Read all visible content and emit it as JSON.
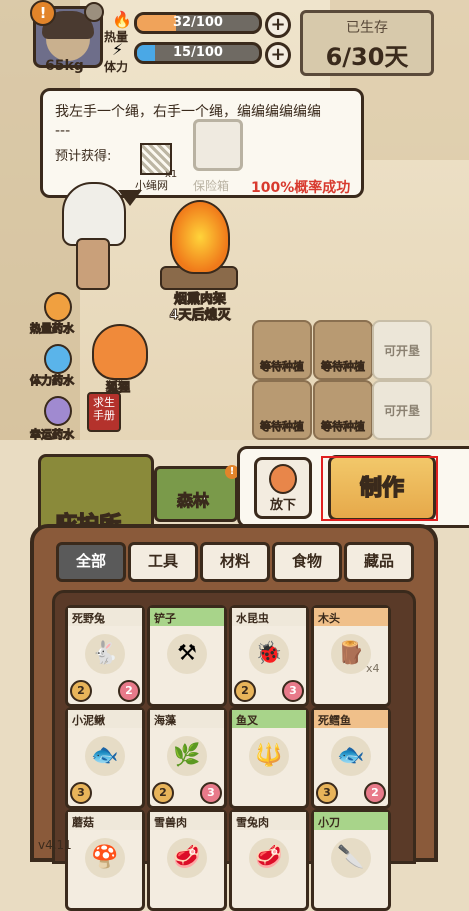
{
  "player": {
    "weight": "65kg",
    "alert_glyph": "!"
  },
  "stats": {
    "heat_label": "热量",
    "heat_value": "32/100",
    "heat_fraction": 0.32,
    "stamina_label": "体力",
    "stamina_value": "15/100",
    "stamina_fraction": 0.15,
    "plus_glyph": "+"
  },
  "survival": {
    "label": "已生存",
    "days": "6/30天"
  },
  "craft_preview": {
    "text": "我左手一个绳，右手一个绳，编编编编编编",
    "divider": "---",
    "expected_label": "预计获得:",
    "item_name": "小绳网",
    "item_count": "x1",
    "box_name": "保险箱",
    "success_rate": "100%概率成功"
  },
  "scene": {
    "fire_text_1": "烟熏肉架",
    "fire_text_2": "4天后熄灭",
    "fox_label": "狐狸",
    "manual_label": "求生手册",
    "potions": [
      "热量药水",
      "体力药水",
      "幸运药水"
    ],
    "plots": [
      "等待种植",
      "等待种植",
      "可开垦",
      "等待种植",
      "等待种植",
      "可开垦"
    ]
  },
  "areas": {
    "shelter_label": "庇护所",
    "forest_label": "森林",
    "forest_alert": "!"
  },
  "actions": {
    "put_down": "放下",
    "craft": "制作"
  },
  "inventory": {
    "tabs": [
      "全部",
      "工具",
      "材料",
      "食物",
      "藏品"
    ],
    "active_tab": 0,
    "items": [
      {
        "name": "死野兔",
        "glyph": "🐇",
        "count": "",
        "a": "2",
        "b": "2",
        "style": ""
      },
      {
        "name": "铲子",
        "glyph": "⚒",
        "count": "",
        "a": "",
        "b": "",
        "style": "green"
      },
      {
        "name": "水昆虫",
        "glyph": "🐞",
        "count": "",
        "a": "2",
        "b": "3",
        "style": ""
      },
      {
        "name": "木头",
        "glyph": "🪵",
        "count": "x4",
        "a": "",
        "b": "",
        "style": "orange"
      },
      {
        "name": "小泥鳅",
        "glyph": "🐟",
        "count": "",
        "a": "3",
        "b": "",
        "style": ""
      },
      {
        "name": "海藻",
        "glyph": "🌿",
        "count": "",
        "a": "2",
        "b": "3",
        "style": ""
      },
      {
        "name": "鱼叉",
        "glyph": "🔱",
        "count": "",
        "a": "",
        "b": "",
        "style": "green"
      },
      {
        "name": "死鳕鱼",
        "glyph": "🐟",
        "count": "",
        "a": "3",
        "b": "2",
        "style": "orange"
      },
      {
        "name": "蘑菇",
        "glyph": "🍄",
        "count": "",
        "a": "",
        "b": "",
        "style": ""
      },
      {
        "name": "雪兽肉",
        "glyph": "🥩",
        "count": "",
        "a": "",
        "b": "",
        "style": ""
      },
      {
        "name": "雪兔肉",
        "glyph": "🥩",
        "count": "",
        "a": "",
        "b": "",
        "style": ""
      },
      {
        "name": "小刀",
        "glyph": "🔪",
        "count": "",
        "a": "",
        "b": "",
        "style": "green"
      }
    ]
  },
  "version": "v4.11"
}
